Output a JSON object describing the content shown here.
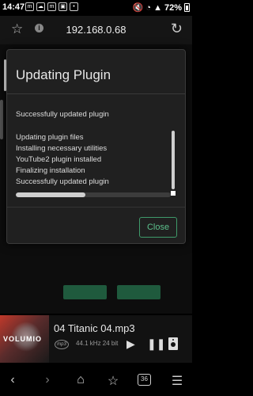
{
  "status_bar": {
    "time": "14:47",
    "notification_icons": [
      "m",
      "☁",
      "m",
      "▣",
      "•"
    ],
    "battery_percent": "72%"
  },
  "browser": {
    "url": "192.168.0.68",
    "favorite_icon": "star-outline-icon",
    "info_icon": "info-icon",
    "reload_icon": "reload-icon"
  },
  "modal": {
    "title": "Updating Plugin",
    "status": "Successfully updated plugin",
    "log": [
      "Updating plugin files",
      "Installing necessary utilities",
      "YouTube2 plugin installed",
      "Finalizing installation",
      "Successfully updated plugin"
    ],
    "progress_fraction": 0.45,
    "close_label": "Close"
  },
  "player": {
    "album_art_text": "VOLUMIO",
    "track_title": "04 Titanic 04.mp3",
    "format_badge": "mp3",
    "quality": "44.1 kHz 24 bit"
  },
  "bottom_nav": {
    "tab_count": "36"
  },
  "colors": {
    "accent_green": "#5cc08c",
    "modal_background": "#202020"
  }
}
